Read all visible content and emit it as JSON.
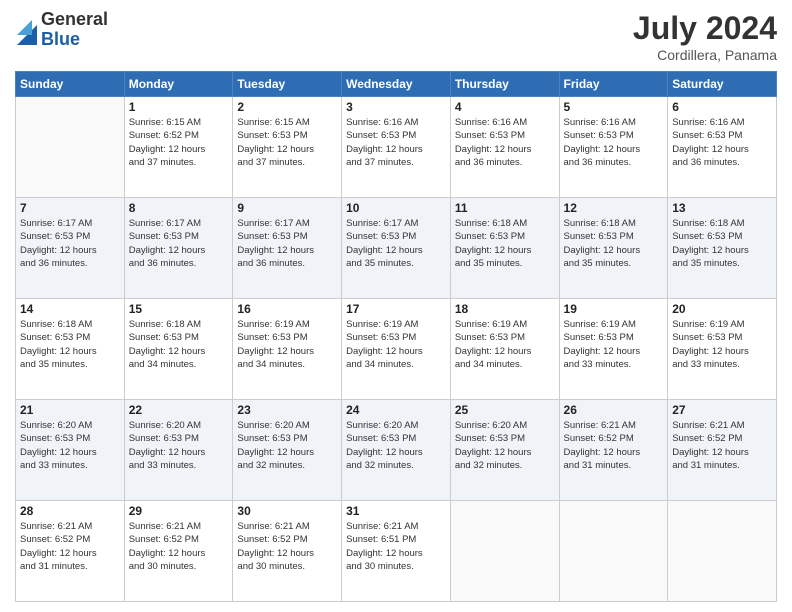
{
  "header": {
    "logo_general": "General",
    "logo_blue": "Blue",
    "month_year": "July 2024",
    "location": "Cordillera, Panama"
  },
  "weekdays": [
    "Sunday",
    "Monday",
    "Tuesday",
    "Wednesday",
    "Thursday",
    "Friday",
    "Saturday"
  ],
  "weeks": [
    [
      {
        "day": "",
        "info": ""
      },
      {
        "day": "1",
        "info": "Sunrise: 6:15 AM\nSunset: 6:52 PM\nDaylight: 12 hours\nand 37 minutes."
      },
      {
        "day": "2",
        "info": "Sunrise: 6:15 AM\nSunset: 6:53 PM\nDaylight: 12 hours\nand 37 minutes."
      },
      {
        "day": "3",
        "info": "Sunrise: 6:16 AM\nSunset: 6:53 PM\nDaylight: 12 hours\nand 37 minutes."
      },
      {
        "day": "4",
        "info": "Sunrise: 6:16 AM\nSunset: 6:53 PM\nDaylight: 12 hours\nand 36 minutes."
      },
      {
        "day": "5",
        "info": "Sunrise: 6:16 AM\nSunset: 6:53 PM\nDaylight: 12 hours\nand 36 minutes."
      },
      {
        "day": "6",
        "info": "Sunrise: 6:16 AM\nSunset: 6:53 PM\nDaylight: 12 hours\nand 36 minutes."
      }
    ],
    [
      {
        "day": "7",
        "info": "Sunrise: 6:17 AM\nSunset: 6:53 PM\nDaylight: 12 hours\nand 36 minutes."
      },
      {
        "day": "8",
        "info": "Sunrise: 6:17 AM\nSunset: 6:53 PM\nDaylight: 12 hours\nand 36 minutes."
      },
      {
        "day": "9",
        "info": "Sunrise: 6:17 AM\nSunset: 6:53 PM\nDaylight: 12 hours\nand 36 minutes."
      },
      {
        "day": "10",
        "info": "Sunrise: 6:17 AM\nSunset: 6:53 PM\nDaylight: 12 hours\nand 35 minutes."
      },
      {
        "day": "11",
        "info": "Sunrise: 6:18 AM\nSunset: 6:53 PM\nDaylight: 12 hours\nand 35 minutes."
      },
      {
        "day": "12",
        "info": "Sunrise: 6:18 AM\nSunset: 6:53 PM\nDaylight: 12 hours\nand 35 minutes."
      },
      {
        "day": "13",
        "info": "Sunrise: 6:18 AM\nSunset: 6:53 PM\nDaylight: 12 hours\nand 35 minutes."
      }
    ],
    [
      {
        "day": "14",
        "info": "Sunrise: 6:18 AM\nSunset: 6:53 PM\nDaylight: 12 hours\nand 35 minutes."
      },
      {
        "day": "15",
        "info": "Sunrise: 6:18 AM\nSunset: 6:53 PM\nDaylight: 12 hours\nand 34 minutes."
      },
      {
        "day": "16",
        "info": "Sunrise: 6:19 AM\nSunset: 6:53 PM\nDaylight: 12 hours\nand 34 minutes."
      },
      {
        "day": "17",
        "info": "Sunrise: 6:19 AM\nSunset: 6:53 PM\nDaylight: 12 hours\nand 34 minutes."
      },
      {
        "day": "18",
        "info": "Sunrise: 6:19 AM\nSunset: 6:53 PM\nDaylight: 12 hours\nand 34 minutes."
      },
      {
        "day": "19",
        "info": "Sunrise: 6:19 AM\nSunset: 6:53 PM\nDaylight: 12 hours\nand 33 minutes."
      },
      {
        "day": "20",
        "info": "Sunrise: 6:19 AM\nSunset: 6:53 PM\nDaylight: 12 hours\nand 33 minutes."
      }
    ],
    [
      {
        "day": "21",
        "info": "Sunrise: 6:20 AM\nSunset: 6:53 PM\nDaylight: 12 hours\nand 33 minutes."
      },
      {
        "day": "22",
        "info": "Sunrise: 6:20 AM\nSunset: 6:53 PM\nDaylight: 12 hours\nand 33 minutes."
      },
      {
        "day": "23",
        "info": "Sunrise: 6:20 AM\nSunset: 6:53 PM\nDaylight: 12 hours\nand 32 minutes."
      },
      {
        "day": "24",
        "info": "Sunrise: 6:20 AM\nSunset: 6:53 PM\nDaylight: 12 hours\nand 32 minutes."
      },
      {
        "day": "25",
        "info": "Sunrise: 6:20 AM\nSunset: 6:53 PM\nDaylight: 12 hours\nand 32 minutes."
      },
      {
        "day": "26",
        "info": "Sunrise: 6:21 AM\nSunset: 6:52 PM\nDaylight: 12 hours\nand 31 minutes."
      },
      {
        "day": "27",
        "info": "Sunrise: 6:21 AM\nSunset: 6:52 PM\nDaylight: 12 hours\nand 31 minutes."
      }
    ],
    [
      {
        "day": "28",
        "info": "Sunrise: 6:21 AM\nSunset: 6:52 PM\nDaylight: 12 hours\nand 31 minutes."
      },
      {
        "day": "29",
        "info": "Sunrise: 6:21 AM\nSunset: 6:52 PM\nDaylight: 12 hours\nand 30 minutes."
      },
      {
        "day": "30",
        "info": "Sunrise: 6:21 AM\nSunset: 6:52 PM\nDaylight: 12 hours\nand 30 minutes."
      },
      {
        "day": "31",
        "info": "Sunrise: 6:21 AM\nSunset: 6:51 PM\nDaylight: 12 hours\nand 30 minutes."
      },
      {
        "day": "",
        "info": ""
      },
      {
        "day": "",
        "info": ""
      },
      {
        "day": "",
        "info": ""
      }
    ]
  ]
}
